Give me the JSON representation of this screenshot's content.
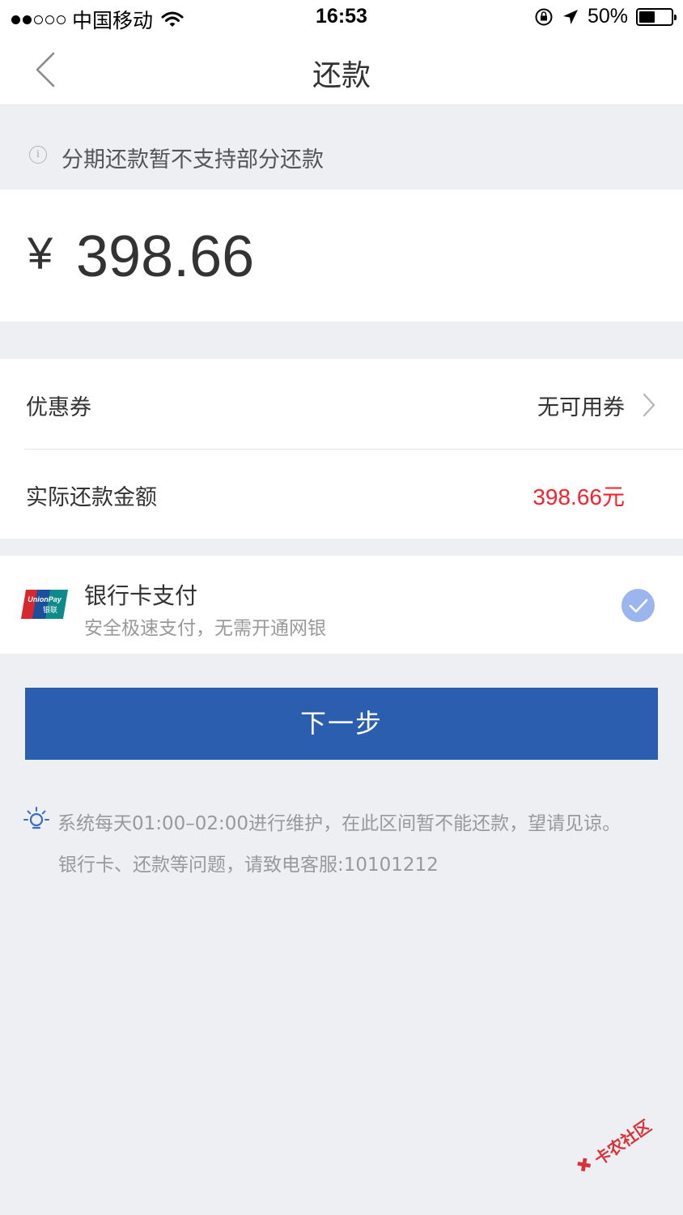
{
  "status_bar": {
    "carrier": "中国移动",
    "time": "16:53",
    "battery": "50%",
    "battery_level": 0.5,
    "signal_bars_filled": 2,
    "signal_bars_total": 5
  },
  "nav": {
    "title": "还款",
    "back_icon": "chevron-left-icon"
  },
  "notice": {
    "text": "分期还款暂不支持部分还款",
    "icon": "info-icon"
  },
  "amount": {
    "currency": "¥",
    "value": "398.66"
  },
  "coupon": {
    "label": "优惠券",
    "value": "无可用券"
  },
  "actual": {
    "label": "实际还款金额",
    "value": "398.66元",
    "color": "#f5222d"
  },
  "payment": {
    "title": "银行卡支付",
    "subtitle": "安全极速支付，无需开通网银",
    "logo_text_top": "UnionPay",
    "logo_text_bottom": "银联",
    "selected": true
  },
  "button": {
    "label": "下一步",
    "color": "#2b5eaf"
  },
  "tips": {
    "line1": "系统每天01:00–02:00进行维护，在此区间暂不能还款，望请见谅。",
    "line2": "银行卡、还款等问题，请致电客服:10101212"
  },
  "watermark": {
    "text": "卡农社区"
  }
}
